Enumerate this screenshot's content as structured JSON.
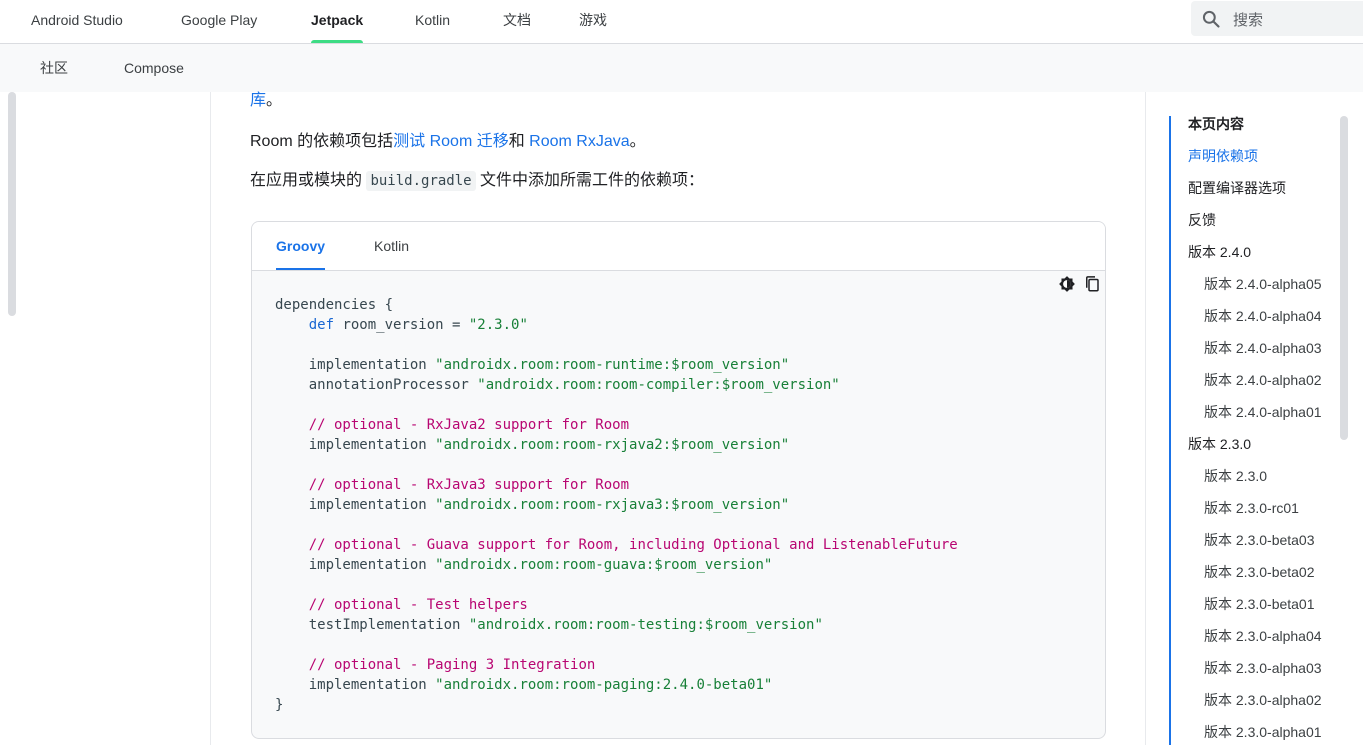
{
  "top_nav": {
    "tabs": [
      {
        "label": "Android Studio"
      },
      {
        "label": "Google Play"
      },
      {
        "label": "Jetpack"
      },
      {
        "label": "Kotlin"
      },
      {
        "label": "文档"
      },
      {
        "label": "游戏"
      }
    ],
    "active_tab": "Jetpack",
    "search_placeholder": "搜索",
    "accent_color": "#3ddc84"
  },
  "sub_nav": {
    "tabs": [
      {
        "label": "社区"
      },
      {
        "label": "Compose"
      }
    ]
  },
  "content": {
    "para0_link": "库",
    "para0_tail": "。",
    "para1": {
      "prefix": "Room 的依赖项包括",
      "link1": "测试 Room 迁移",
      "mid": "和 ",
      "link2": "Room RxJava",
      "suffix": "。"
    },
    "para2": {
      "prefix": "在应用或模块的 ",
      "code": "build.gradle",
      "suffix": " 文件中添加所需工件的依赖项："
    },
    "link_color": "#1a73e8"
  },
  "code_widget": {
    "tabs": [
      {
        "label": "Groovy"
      },
      {
        "label": "Kotlin"
      }
    ],
    "active_tab": "Groovy",
    "lines": [
      [
        {
          "t": "plain",
          "v": "dependencies {"
        }
      ],
      [
        {
          "t": "plain",
          "v": "    "
        },
        {
          "t": "kw",
          "v": "def"
        },
        {
          "t": "plain",
          "v": " room_version = "
        },
        {
          "t": "str",
          "v": "\"2.3.0\""
        }
      ],
      [],
      [
        {
          "t": "plain",
          "v": "    implementation "
        },
        {
          "t": "str",
          "v": "\"androidx.room:room-runtime:$room_version\""
        }
      ],
      [
        {
          "t": "plain",
          "v": "    annotationProcessor "
        },
        {
          "t": "str",
          "v": "\"androidx.room:room-compiler:$room_version\""
        }
      ],
      [],
      [
        {
          "t": "plain",
          "v": "    "
        },
        {
          "t": "cm",
          "v": "// optional - RxJava2 support for Room"
        }
      ],
      [
        {
          "t": "plain",
          "v": "    implementation "
        },
        {
          "t": "str",
          "v": "\"androidx.room:room-rxjava2:$room_version\""
        }
      ],
      [],
      [
        {
          "t": "plain",
          "v": "    "
        },
        {
          "t": "cm",
          "v": "// optional - RxJava3 support for Room"
        }
      ],
      [
        {
          "t": "plain",
          "v": "    implementation "
        },
        {
          "t": "str",
          "v": "\"androidx.room:room-rxjava3:$room_version\""
        }
      ],
      [],
      [
        {
          "t": "plain",
          "v": "    "
        },
        {
          "t": "cm",
          "v": "// optional - Guava support for Room, including Optional and ListenableFuture"
        }
      ],
      [
        {
          "t": "plain",
          "v": "    implementation "
        },
        {
          "t": "str",
          "v": "\"androidx.room:room-guava:$room_version\""
        }
      ],
      [],
      [
        {
          "t": "plain",
          "v": "    "
        },
        {
          "t": "cm",
          "v": "// optional - Test helpers"
        }
      ],
      [
        {
          "t": "plain",
          "v": "    testImplementation "
        },
        {
          "t": "str",
          "v": "\"androidx.room:room-testing:$room_version\""
        }
      ],
      [],
      [
        {
          "t": "plain",
          "v": "    "
        },
        {
          "t": "cm",
          "v": "// optional - Paging 3 Integration"
        }
      ],
      [
        {
          "t": "plain",
          "v": "    implementation "
        },
        {
          "t": "str",
          "v": "\"androidx.room:room-paging:2.4.0-beta01\""
        }
      ],
      [
        {
          "t": "plain",
          "v": "}"
        }
      ]
    ],
    "colors": {
      "keyword": "#1967d2",
      "string": "#188038",
      "comment": "#b80672"
    },
    "tools": [
      {
        "icon": "theme-toggle-icon"
      },
      {
        "icon": "copy-icon"
      }
    ]
  },
  "toc": {
    "title": "本页内容",
    "active": "声明依赖项",
    "items": [
      {
        "label": "声明依赖项",
        "level": 1
      },
      {
        "label": "配置编译器选项",
        "level": 1
      },
      {
        "label": "反馈",
        "level": 1
      },
      {
        "label": "版本 2.4.0",
        "level": 1
      },
      {
        "label": "版本 2.4.0-alpha05",
        "level": 2
      },
      {
        "label": "版本 2.4.0-alpha04",
        "level": 2
      },
      {
        "label": "版本 2.4.0-alpha03",
        "level": 2
      },
      {
        "label": "版本 2.4.0-alpha02",
        "level": 2
      },
      {
        "label": "版本 2.4.0-alpha01",
        "level": 2
      },
      {
        "label": "版本 2.3.0",
        "level": 1
      },
      {
        "label": "版本 2.3.0",
        "level": 2
      },
      {
        "label": "版本 2.3.0-rc01",
        "level": 2
      },
      {
        "label": "版本 2.3.0-beta03",
        "level": 2
      },
      {
        "label": "版本 2.3.0-beta02",
        "level": 2
      },
      {
        "label": "版本 2.3.0-beta01",
        "level": 2
      },
      {
        "label": "版本 2.3.0-alpha04",
        "level": 2
      },
      {
        "label": "版本 2.3.0-alpha03",
        "level": 2
      },
      {
        "label": "版本 2.3.0-alpha02",
        "level": 2
      },
      {
        "label": "版本 2.3.0-alpha01",
        "level": 2
      }
    ]
  }
}
